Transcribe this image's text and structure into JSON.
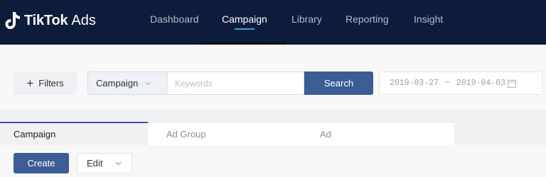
{
  "brand": {
    "name": "TikTok",
    "suffix": "Ads"
  },
  "nav": {
    "items": [
      {
        "label": "Dashboard",
        "active": false
      },
      {
        "label": "Campaign",
        "active": true
      },
      {
        "label": "Library",
        "active": false
      },
      {
        "label": "Reporting",
        "active": false
      },
      {
        "label": "Insight",
        "active": false
      }
    ]
  },
  "filters": {
    "label": "Filters"
  },
  "search": {
    "scope": "Campaign",
    "placeholder": "Keywords",
    "button": "Search"
  },
  "date_range": {
    "start": "2019-03-27",
    "separator": "~",
    "end": "2019-04-03"
  },
  "tabs": [
    {
      "label": "Campaign",
      "active": true
    },
    {
      "label": "Ad Group",
      "active": false
    },
    {
      "label": "Ad",
      "active": false
    }
  ],
  "actions": {
    "create": "Create",
    "edit": "Edit"
  },
  "colors": {
    "nav_bg": "#0c1c3a",
    "accent": "#3b5c95",
    "nav_highlight": "#3ea2e8"
  }
}
